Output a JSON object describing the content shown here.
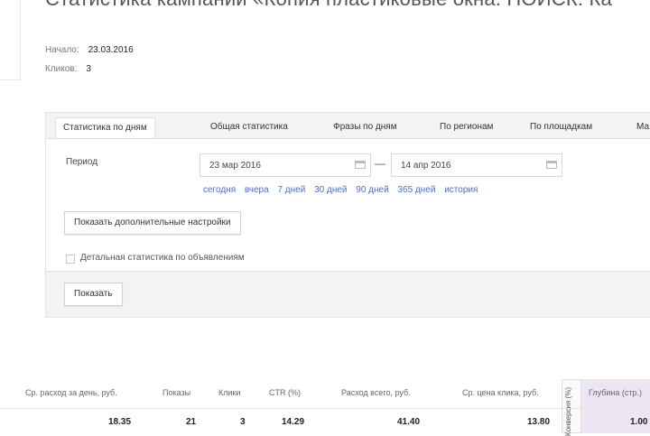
{
  "page": {
    "title": "Статистика кампании «Копия пластиковые окна. ПОИСК. Ка"
  },
  "meta": {
    "start_label": "Начало:",
    "start_value": "23.03.2016",
    "clicks_label": "Кликов:",
    "clicks_value": "3"
  },
  "tabs": [
    {
      "label": "Статистика по дням",
      "active": true
    },
    {
      "label": "Общая статистика",
      "active": false
    },
    {
      "label": "Фразы по дням",
      "active": false
    },
    {
      "label": "По регионам",
      "active": false
    },
    {
      "label": "По площадкам",
      "active": false
    },
    {
      "label": "Ма",
      "active": false
    }
  ],
  "period": {
    "label": "Период",
    "from": "23 мар 2016",
    "to": "14 апр 2016",
    "separator": "—"
  },
  "quick_links": [
    "сегодня",
    "вчера",
    "7 дней",
    "30 дней",
    "90 дней",
    "365 дней",
    "история"
  ],
  "buttons": {
    "more_settings": "Показать дополнительные настройки",
    "show": "Показать"
  },
  "detail_checkbox": {
    "label": "Детальная статистика по объявлениям",
    "checked": false
  },
  "table": {
    "headers": [
      "Ср. расход за день, руб.",
      "Показы",
      "Клики",
      "CTR (%)",
      "Расход всего, руб.",
      "Ср. цена клика, руб.",
      "Глубина (стр.)"
    ],
    "vertical_header": "Конверсия (%)",
    "row": [
      "18.35",
      "21",
      "3",
      "14.29",
      "41.40",
      "13.80",
      "1.00"
    ]
  },
  "colors": {
    "link": "#4a6fc8",
    "highlight_column": "#ece6f3",
    "panel_bg": "#f3f3f3"
  }
}
